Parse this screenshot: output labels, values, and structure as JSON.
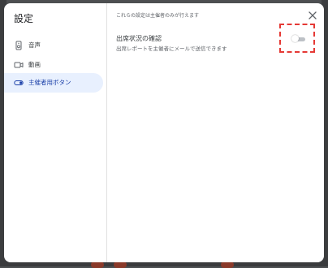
{
  "dialog": {
    "title": "設定",
    "notice": "これらの設定は主催者のみが行えます",
    "close_icon": "close-icon"
  },
  "sidebar": {
    "items": [
      {
        "label": "音声",
        "icon": "speaker-icon",
        "active": false
      },
      {
        "label": "動画",
        "icon": "video-camera-icon",
        "active": false
      },
      {
        "label": "主催者用ボタン",
        "icon": "toggle-icon",
        "active": true
      }
    ]
  },
  "setting": {
    "title": "出席状況の確認",
    "description": "出席レポートを主催者にメールで送信できます",
    "enabled": false
  },
  "colors": {
    "accent": "#1a3fa8",
    "active_bg": "#e8f0fe",
    "highlight": "#e53935"
  }
}
